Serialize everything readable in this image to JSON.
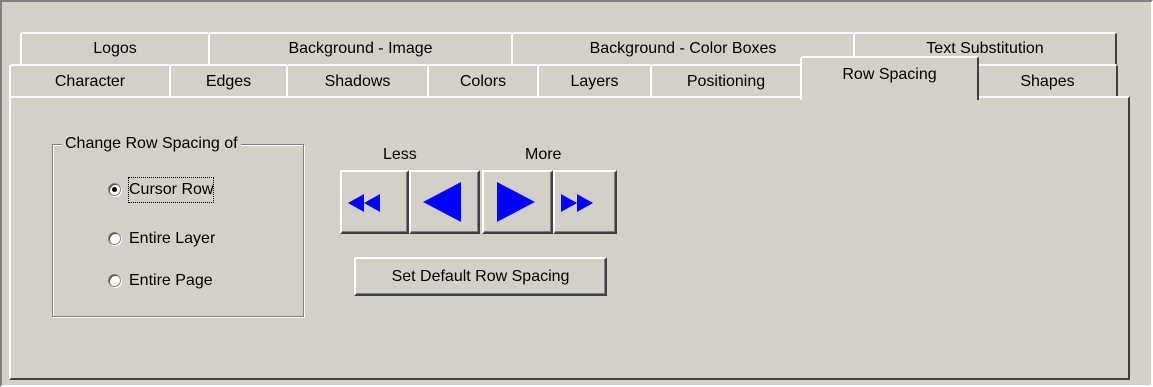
{
  "tabs": {
    "row1": [
      "Logos",
      "Background - Image",
      "Background - Color Boxes",
      "Text Substitution"
    ],
    "row2": [
      "Character",
      "Edges",
      "Shadows",
      "Colors",
      "Layers",
      "Positioning",
      "Row Spacing",
      "Shapes"
    ],
    "active": "Row Spacing"
  },
  "row_spacing": {
    "group_title": "Change Row Spacing of",
    "options": [
      "Cursor Row",
      "Entire Layer",
      "Entire Page"
    ],
    "selected": "Cursor Row",
    "less_label": "Less",
    "more_label": "More",
    "buttons": {
      "much_less_icon": "double-left-arrow-icon",
      "less_icon": "left-arrow-icon",
      "more_icon": "right-arrow-icon",
      "much_more_icon": "double-right-arrow-icon",
      "arrow_color": "#0000ff"
    },
    "default_button_label": "Set Default Row Spacing"
  }
}
